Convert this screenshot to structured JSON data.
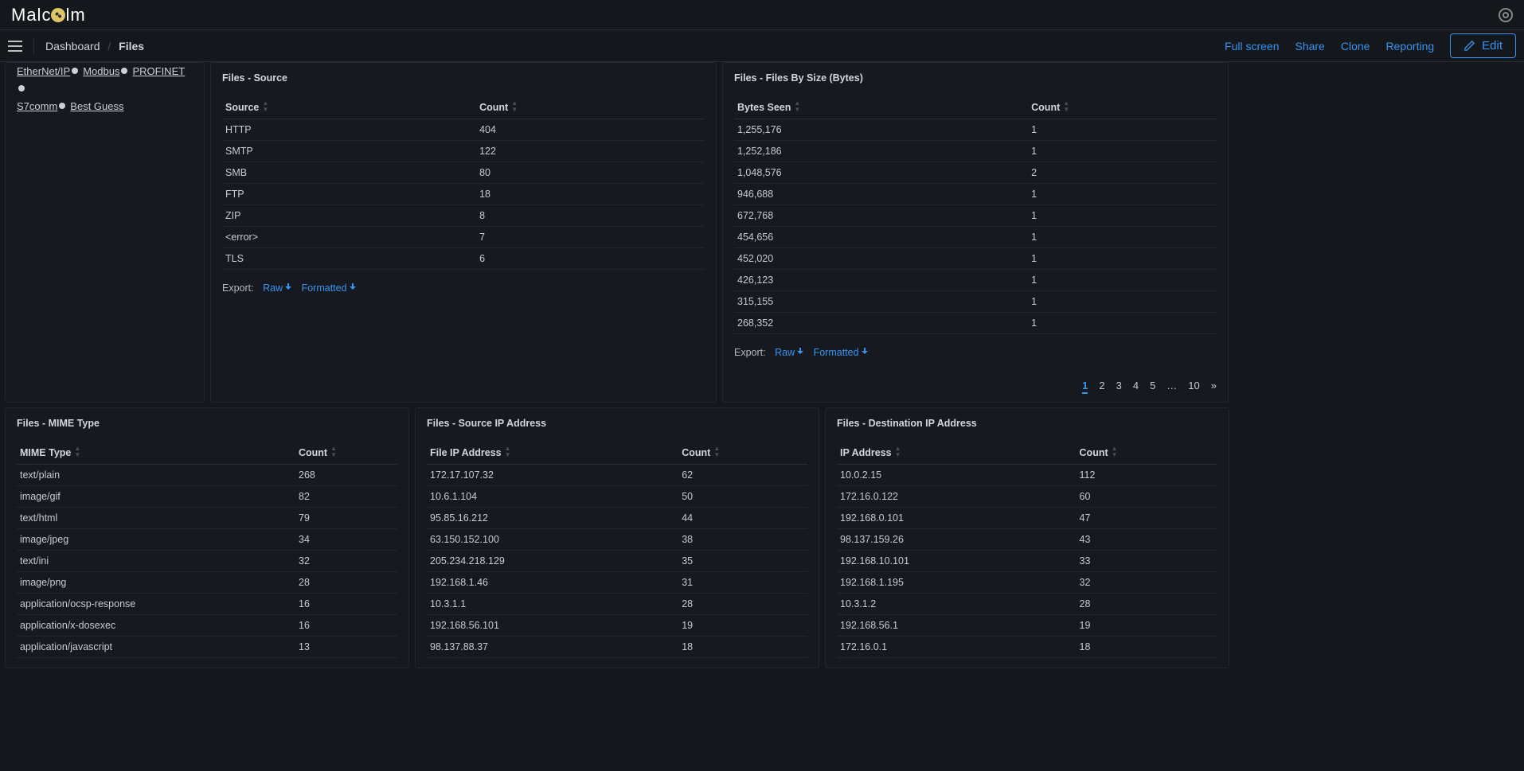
{
  "logo_text_pre": "Malc",
  "logo_text_post": "lm",
  "breadcrumb": {
    "dashboard": "Dashboard",
    "page": "Files"
  },
  "nav": {
    "full_screen": "Full screen",
    "share": "Share",
    "clone": "Clone",
    "reporting": "Reporting",
    "edit": "Edit"
  },
  "protocols": {
    "line1_items": [
      "EtherNet/IP",
      "Modbus",
      "PROFINET"
    ],
    "line2_items": [
      "S7comm",
      "Best Guess"
    ]
  },
  "export": {
    "label": "Export:",
    "raw": "Raw",
    "formatted": "Formatted"
  },
  "count_header": "Count",
  "panel_source": {
    "title": "Files - Source",
    "col1": "Source",
    "rows": [
      {
        "k": "HTTP",
        "v": "404"
      },
      {
        "k": "SMTP",
        "v": "122"
      },
      {
        "k": "SMB",
        "v": "80"
      },
      {
        "k": "FTP",
        "v": "18"
      },
      {
        "k": "ZIP",
        "v": "8"
      },
      {
        "k": "<error>",
        "v": "7"
      },
      {
        "k": "TLS",
        "v": "6"
      }
    ]
  },
  "panel_bysize": {
    "title": "Files - Files By Size (Bytes)",
    "col1": "Bytes Seen",
    "rows": [
      {
        "k": "1,255,176",
        "v": "1"
      },
      {
        "k": "1,252,186",
        "v": "1"
      },
      {
        "k": "1,048,576",
        "v": "2"
      },
      {
        "k": "946,688",
        "v": "1"
      },
      {
        "k": "672,768",
        "v": "1"
      },
      {
        "k": "454,656",
        "v": "1"
      },
      {
        "k": "452,020",
        "v": "1"
      },
      {
        "k": "426,123",
        "v": "1"
      },
      {
        "k": "315,155",
        "v": "1"
      },
      {
        "k": "268,352",
        "v": "1"
      }
    ],
    "pager": [
      "1",
      "2",
      "3",
      "4",
      "5",
      "…",
      "10",
      "»"
    ]
  },
  "panel_mime": {
    "title": "Files - MIME Type",
    "col1": "MIME Type",
    "rows": [
      {
        "k": "text/plain",
        "v": "268"
      },
      {
        "k": "image/gif",
        "v": "82"
      },
      {
        "k": "text/html",
        "v": "79"
      },
      {
        "k": "image/jpeg",
        "v": "34"
      },
      {
        "k": "text/ini",
        "v": "32"
      },
      {
        "k": "image/png",
        "v": "28"
      },
      {
        "k": "application/ocsp-response",
        "v": "16"
      },
      {
        "k": "application/x-dosexec",
        "v": "16"
      },
      {
        "k": "application/javascript",
        "v": "13"
      }
    ]
  },
  "panel_srcip": {
    "title": "Files - Source IP Address",
    "col1": "File IP Address",
    "rows": [
      {
        "k": "172.17.107.32",
        "v": "62"
      },
      {
        "k": "10.6.1.104",
        "v": "50"
      },
      {
        "k": "95.85.16.212",
        "v": "44"
      },
      {
        "k": "63.150.152.100",
        "v": "38"
      },
      {
        "k": "205.234.218.129",
        "v": "35"
      },
      {
        "k": "192.168.1.46",
        "v": "31"
      },
      {
        "k": "10.3.1.1",
        "v": "28"
      },
      {
        "k": "192.168.56.101",
        "v": "19"
      },
      {
        "k": "98.137.88.37",
        "v": "18"
      }
    ]
  },
  "panel_dstip": {
    "title": "Files - Destination IP Address",
    "col1": "IP Address",
    "rows": [
      {
        "k": "10.0.2.15",
        "v": "112"
      },
      {
        "k": "172.16.0.122",
        "v": "60"
      },
      {
        "k": "192.168.0.101",
        "v": "47"
      },
      {
        "k": "98.137.159.26",
        "v": "43"
      },
      {
        "k": "192.168.10.101",
        "v": "33"
      },
      {
        "k": "192.168.1.195",
        "v": "32"
      },
      {
        "k": "10.3.1.2",
        "v": "28"
      },
      {
        "k": "192.168.56.1",
        "v": "19"
      },
      {
        "k": "172.16.0.1",
        "v": "18"
      }
    ]
  }
}
